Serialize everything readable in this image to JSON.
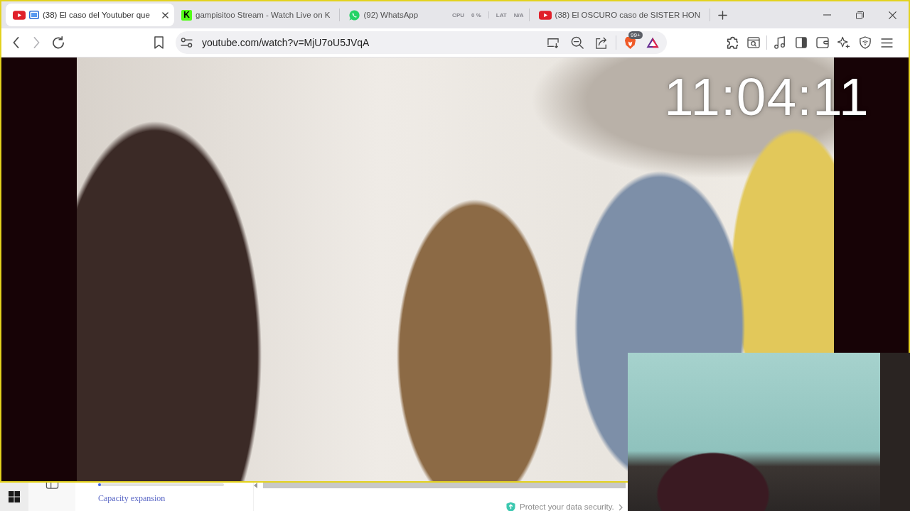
{
  "tabs": [
    {
      "kind": "video",
      "title": "(38) El caso del Youtuber que",
      "selected": true,
      "sharing": true
    },
    {
      "kind": "stream",
      "logo_text": "K",
      "title": "gampisitoo Stream - Watch Live on K",
      "selected": false,
      "sharing": false
    },
    {
      "kind": "chat",
      "title": "(92) WhatsApp",
      "selected": false,
      "sharing": false
    },
    {
      "kind": "video",
      "title": "(38) El OSCURO caso de SISTER HON",
      "selected": false,
      "sharing": false
    }
  ],
  "perf_overlay": [
    {
      "label": "CPU",
      "value": "0 %"
    },
    {
      "label": "LAT",
      "value": "N/A"
    }
  ],
  "toolbar": {
    "back": {
      "disabled": false
    },
    "forward": {
      "disabled": true
    },
    "address": {
      "url": "youtube.com/watch?v=MjU7oU5JVqA"
    },
    "shields_badge": "99+"
  },
  "video": {
    "clock": "11:04:11"
  },
  "desktop": {
    "progress": {
      "level": 0.02
    },
    "link": "Capacity expansion",
    "notice": "Protect your data security."
  }
}
